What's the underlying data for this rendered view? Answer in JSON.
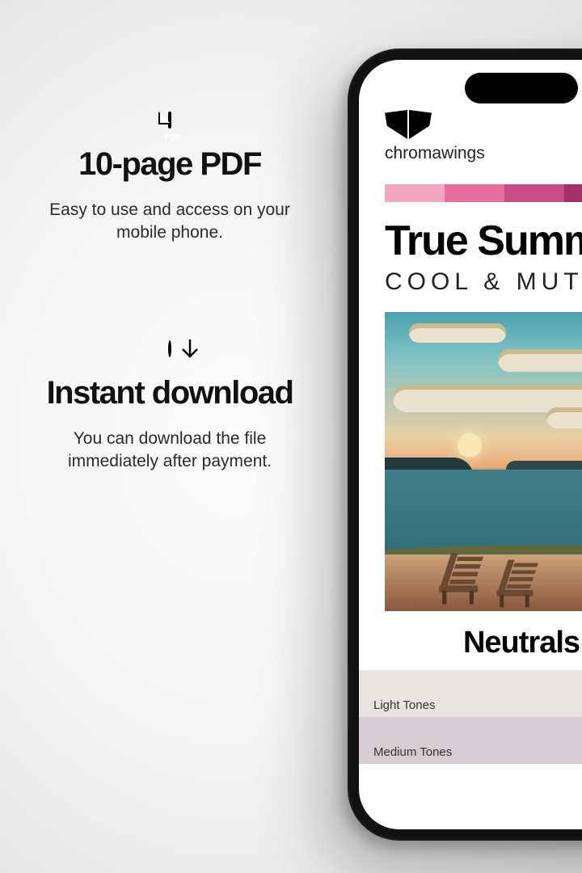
{
  "features": {
    "pdf": {
      "icon_label": "PDF",
      "title": "10-page PDF",
      "desc": "Easy to use and access on your mobile phone."
    },
    "download": {
      "title": "Instant download",
      "desc": "You can download the file immediately after payment."
    }
  },
  "phone": {
    "brand": "chromawings",
    "doc_title": "True Summer",
    "doc_subtitle": "COOL & MUTED",
    "section_title": "Neutrals",
    "tone_light_label": "Light Tones",
    "tone_medium_label": "Medium Tones",
    "palette_strip": [
      "#f3a6c0",
      "#e66f9e",
      "#c94b84",
      "#a02f6a",
      "#7c1f55"
    ]
  }
}
